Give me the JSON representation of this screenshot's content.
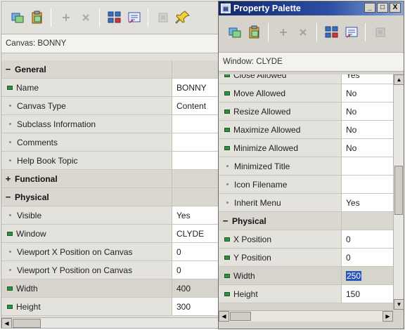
{
  "left": {
    "context_label": "Canvas: BONNY",
    "toolbar": {
      "buttons": [
        {
          "icon": "copy-properties-icon",
          "enabled": true
        },
        {
          "icon": "paste-properties-icon",
          "enabled": true
        },
        {
          "icon": "add-property-icon",
          "enabled": false
        },
        {
          "icon": "delete-property-icon",
          "enabled": false
        },
        {
          "icon": "union-intersection-icon",
          "enabled": true
        },
        {
          "icon": "property-inherit-icon",
          "enabled": true
        },
        {
          "icon": "freeze-icon",
          "enabled": false
        },
        {
          "icon": "pin-icon",
          "enabled": true
        }
      ]
    },
    "rows": [
      {
        "type": "section",
        "expander": "−",
        "name": "General",
        "value": ""
      },
      {
        "type": "prop",
        "marker": "green",
        "name": "Name",
        "value": "BONNY"
      },
      {
        "type": "prop",
        "marker": "dot",
        "name": "Canvas Type",
        "value": "Content"
      },
      {
        "type": "prop",
        "marker": "dot",
        "name": "Subclass Information",
        "value": ""
      },
      {
        "type": "prop",
        "marker": "dot",
        "name": "Comments",
        "value": ""
      },
      {
        "type": "prop",
        "marker": "dot",
        "name": "Help Book Topic",
        "value": ""
      },
      {
        "type": "section",
        "expander": "+",
        "name": "Functional",
        "value": ""
      },
      {
        "type": "section",
        "expander": "−",
        "name": "Physical",
        "value": ""
      },
      {
        "type": "prop",
        "marker": "dot",
        "name": "Visible",
        "value": "Yes"
      },
      {
        "type": "prop",
        "marker": "green",
        "name": "Window",
        "value": "CLYDE"
      },
      {
        "type": "prop",
        "marker": "dot",
        "name": "Viewport X Position on Canvas",
        "value": "0"
      },
      {
        "type": "prop",
        "marker": "dot",
        "name": "Viewport Y Position on Canvas",
        "value": "0"
      },
      {
        "type": "prop",
        "marker": "green",
        "name": "Width",
        "value": "400",
        "shaded": true
      },
      {
        "type": "prop",
        "marker": "green",
        "name": "Height",
        "value": "300"
      }
    ]
  },
  "right": {
    "window_title": "Property Palette",
    "window_buttons": {
      "minimize": "_",
      "maximize": "□",
      "close": "X"
    },
    "context_label": "Window: CLYDE",
    "toolbar": {
      "buttons": [
        {
          "icon": "copy-properties-icon",
          "enabled": true
        },
        {
          "icon": "paste-properties-icon",
          "enabled": true
        },
        {
          "icon": "add-property-icon",
          "enabled": false
        },
        {
          "icon": "delete-property-icon",
          "enabled": false
        },
        {
          "icon": "union-intersection-icon",
          "enabled": true
        },
        {
          "icon": "property-inherit-icon",
          "enabled": true
        },
        {
          "icon": "freeze-icon",
          "enabled": false
        }
      ]
    },
    "rows": [
      {
        "type": "prop",
        "marker": "green",
        "name": "Close Allowed",
        "value": "Yes",
        "clipped": true
      },
      {
        "type": "prop",
        "marker": "green",
        "name": "Move Allowed",
        "value": "No"
      },
      {
        "type": "prop",
        "marker": "green",
        "name": "Resize Allowed",
        "value": "No"
      },
      {
        "type": "prop",
        "marker": "green",
        "name": "Maximize Allowed",
        "value": "No"
      },
      {
        "type": "prop",
        "marker": "green",
        "name": "Minimize Allowed",
        "value": "No"
      },
      {
        "type": "prop",
        "marker": "dot",
        "name": "Minimized Title",
        "value": ""
      },
      {
        "type": "prop",
        "marker": "dot",
        "name": "Icon Filename",
        "value": ""
      },
      {
        "type": "prop",
        "marker": "dot",
        "name": "Inherit Menu",
        "value": "Yes"
      },
      {
        "type": "section",
        "expander": "−",
        "name": "Physical",
        "value": ""
      },
      {
        "type": "prop",
        "marker": "green",
        "name": "X Position",
        "value": "0"
      },
      {
        "type": "prop",
        "marker": "green",
        "name": "Y Position",
        "value": "0"
      },
      {
        "type": "prop",
        "marker": "green",
        "name": "Width",
        "value": "250",
        "shaded": true,
        "selected": true
      },
      {
        "type": "prop",
        "marker": "green",
        "name": "Height",
        "value": "150"
      }
    ]
  },
  "colors": {
    "title_bar": "#12286a",
    "green_marker": "#2f8f3a",
    "selection": "#2b55b8"
  }
}
